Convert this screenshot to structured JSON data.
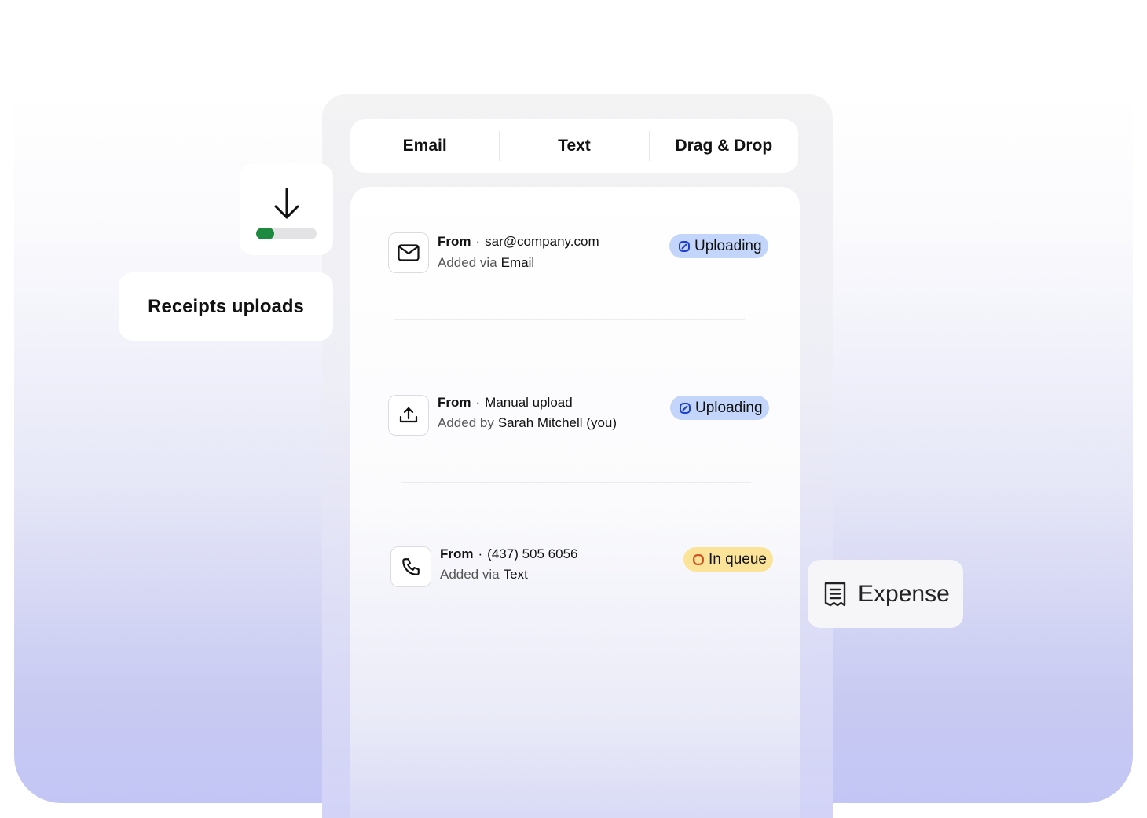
{
  "tabs": [
    {
      "label": "Email"
    },
    {
      "label": "Text"
    },
    {
      "label": "Drag & Drop"
    }
  ],
  "uploads": [
    {
      "icon": "mail-icon",
      "from_label": "From",
      "source": "sar@company.com",
      "added_label": "Added via",
      "added_value": "Email",
      "status": "Uploading",
      "status_color": "#c3d5fb"
    },
    {
      "icon": "upload-icon",
      "from_label": "From",
      "source": "Manual upload",
      "added_label": "Added by",
      "added_value": "Sarah Mitchell (you)",
      "status": "Uploading",
      "status_color": "#c3d5fb"
    },
    {
      "icon": "phone-icon",
      "from_label": "From",
      "source": "(437) 505 6056",
      "added_label": "Added via",
      "added_value": "Text",
      "status": "In queue",
      "status_color": "#fbe49a"
    }
  ],
  "download_widget": {
    "icon": "arrow-down-icon",
    "progress_fraction": 0.3,
    "progress_color": "#1e8a3f"
  },
  "receipts_card": {
    "label": "Receipts uploads"
  },
  "expense_card": {
    "icon": "receipt-icon",
    "label": "Expense"
  }
}
